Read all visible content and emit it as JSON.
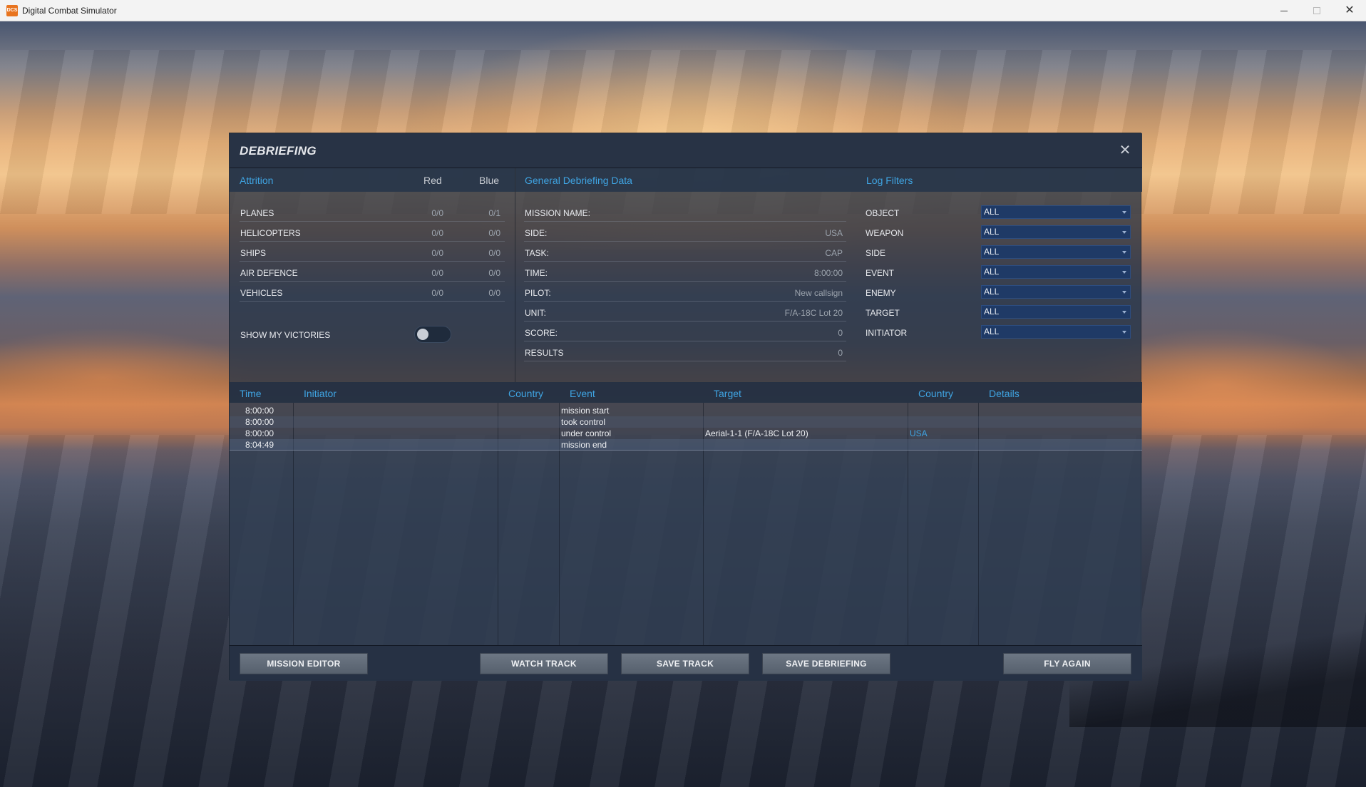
{
  "window": {
    "title": "Digital Combat Simulator",
    "icon_text": "DCS"
  },
  "dialog": {
    "title": "DEBRIEFING"
  },
  "attrition": {
    "title": "Attrition",
    "col_red": "Red",
    "col_blue": "Blue",
    "rows": [
      {
        "label": "PLANES",
        "red": "0/0",
        "blue": "0/1"
      },
      {
        "label": "HELICOPTERS",
        "red": "0/0",
        "blue": "0/0"
      },
      {
        "label": "SHIPS",
        "red": "0/0",
        "blue": "0/0"
      },
      {
        "label": "AIR DEFENCE",
        "red": "0/0",
        "blue": "0/0"
      },
      {
        "label": "VEHICLES",
        "red": "0/0",
        "blue": "0/0"
      }
    ],
    "show_victories_label": "SHOW MY VICTORIES",
    "show_victories_on": false
  },
  "general": {
    "title": "General Debriefing Data",
    "rows": [
      {
        "label": "MISSION NAME:",
        "value": ""
      },
      {
        "label": "SIDE:",
        "value": "USA"
      },
      {
        "label": "TASK:",
        "value": "CAP"
      },
      {
        "label": "TIME:",
        "value": "8:00:00"
      },
      {
        "label": "PILOT:",
        "value": "New callsign"
      },
      {
        "label": "UNIT:",
        "value": "F/A-18C Lot 20"
      },
      {
        "label": "SCORE:",
        "value": "0"
      },
      {
        "label": "RESULTS",
        "value": "0"
      }
    ]
  },
  "filters": {
    "title": "Log Filters",
    "rows": [
      {
        "label": "OBJECT",
        "value": "ALL"
      },
      {
        "label": "WEAPON",
        "value": "ALL"
      },
      {
        "label": "SIDE",
        "value": "ALL"
      },
      {
        "label": "EVENT",
        "value": "ALL"
      },
      {
        "label": "ENEMY",
        "value": "ALL"
      },
      {
        "label": "TARGET",
        "value": "ALL"
      },
      {
        "label": "INITIATOR",
        "value": "ALL"
      }
    ]
  },
  "log": {
    "columns": {
      "time": "Time",
      "initiator": "Initiator",
      "country": "Country",
      "event": "Event",
      "target": "Target",
      "target_country": "Country",
      "details": "Details"
    },
    "rows": [
      {
        "time": "8:00:00",
        "initiator": "",
        "country": "",
        "event": "mission start",
        "target": "",
        "target_country": "",
        "details": ""
      },
      {
        "time": "8:00:00",
        "initiator": "",
        "country": "",
        "event": "took control",
        "target": "",
        "target_country": "",
        "details": ""
      },
      {
        "time": "8:00:00",
        "initiator": "",
        "country": "",
        "event": "under control",
        "target": "Aerial-1-1 (F/A-18C Lot 20)",
        "target_country": "USA",
        "details": ""
      },
      {
        "time": "8:04:49",
        "initiator": "",
        "country": "",
        "event": "mission end",
        "target": "",
        "target_country": "",
        "details": ""
      }
    ]
  },
  "footer": {
    "mission_editor": "MISSION EDITOR",
    "watch_track": "WATCH TRACK",
    "save_track": "SAVE TRACK",
    "save_debriefing": "SAVE DEBRIEFING",
    "fly_again": "FLY AGAIN"
  },
  "icons": {
    "close": "close-icon",
    "dropdown": "chevron-down-icon"
  }
}
